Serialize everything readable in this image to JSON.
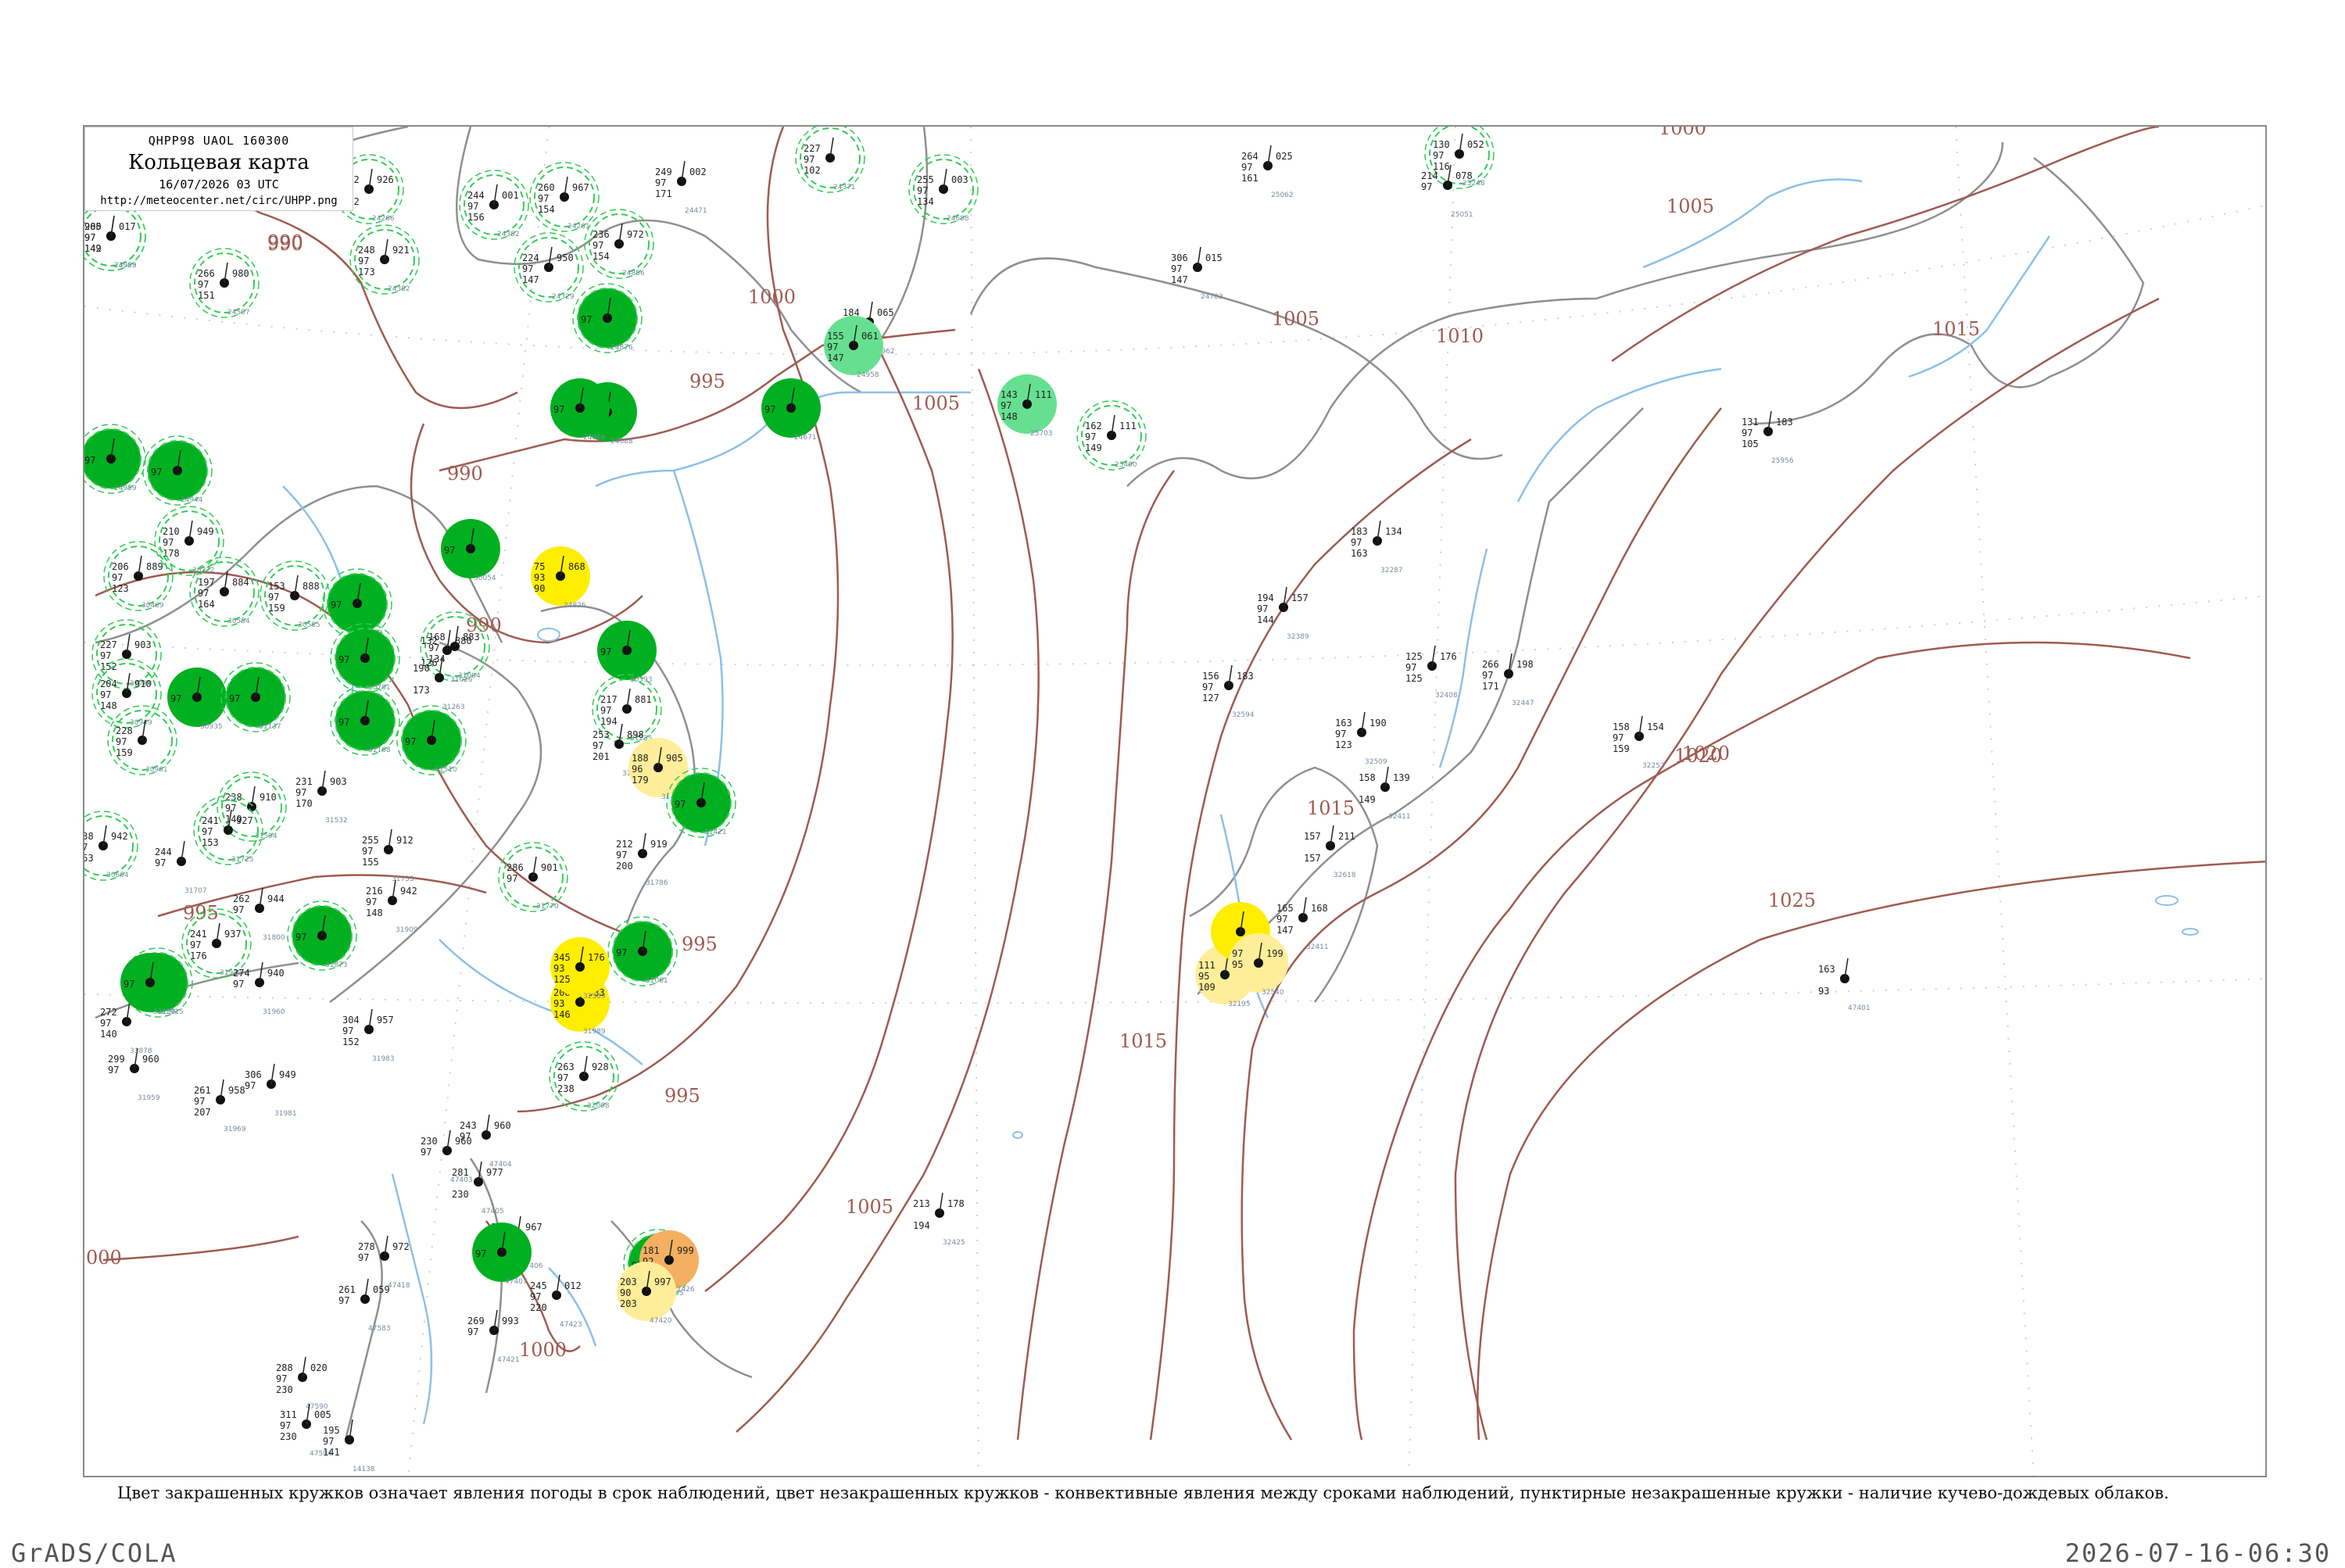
{
  "header": {
    "code": "QHPP98  UAOL  160300",
    "title": "Кольцевая карта",
    "date": "16/07/2026 03 UTC",
    "url": "http://meteocenter.net/circ/UHPP.png"
  },
  "caption": "Цвет закрашенных кружков означает явления погоды в срок наблюдений, цвет незакрашенных кружков - конвективные явления между сроками наблюдений, пунктирные незакрашенные кружки - наличие кучево-дождевых облаков.",
  "footer": {
    "left": "GrADS/COLA",
    "right": "2026-07-16-06:30"
  },
  "colors": {
    "isobar": "#a05a50",
    "coast": "#9a9a9a",
    "river": "#7fb2e0",
    "rain": "#00b020",
    "light_rain": "#66e090",
    "drizzle": "#ffee00",
    "fog": "#ffee99",
    "thunder_dash": "#33cc55",
    "orange": "#f4b060"
  },
  "isobars": [
    {
      "label": "1000",
      "color": "isobar"
    },
    {
      "label": "995",
      "color": "isobar"
    },
    {
      "label": "990",
      "color": "isobar"
    },
    {
      "label": "1005",
      "color": "isobar"
    },
    {
      "label": "1010",
      "color": "isobar"
    },
    {
      "label": "1015",
      "color": "isobar"
    },
    {
      "label": "1020",
      "color": "isobar"
    },
    {
      "label": "1025",
      "color": "isobar"
    },
    {
      "label": "1000",
      "color": "isobar"
    },
    {
      "label": "990",
      "color": "isobar"
    },
    {
      "label": "995",
      "color": "isobar"
    },
    {
      "label": "1005",
      "color": "isobar"
    },
    {
      "label": "1015",
      "color": "isobar"
    },
    {
      "label": "1005",
      "color": "isobar"
    },
    {
      "label": "1015",
      "color": "isobar"
    },
    {
      "label": "990",
      "color": "isobar"
    },
    {
      "label": "995",
      "color": "isobar"
    },
    {
      "label": "1000",
      "color": "isobar"
    },
    {
      "label": "000",
      "color": "isobar"
    },
    {
      "label": "995",
      "color": "isobar"
    },
    {
      "label": "1005",
      "color": "isobar"
    },
    {
      "label": "990",
      "color": "isobar"
    },
    {
      "label": "1020",
      "color": "isobar"
    }
  ],
  "stations": [
    {
      "id": "24959",
      "t": "205",
      "p": "97",
      "d": "149",
      "v": "017",
      "fill": "none",
      "dash": true
    },
    {
      "id": "24266",
      "t": "242",
      "p": "97",
      "d": "252",
      "v": "926",
      "fill": "none",
      "dash": true
    },
    {
      "id": "24382",
      "t": "244",
      "p": "97",
      "d": "156",
      "v": "001",
      "fill": "none",
      "dash": true
    },
    {
      "id": "24261",
      "t": "260",
      "p": "97",
      "d": "154",
      "v": "967",
      "fill": "none",
      "dash": true
    },
    {
      "id": "24471",
      "t": "249",
      "p": "97",
      "d": "171",
      "v": "002",
      "fill": "none",
      "dash": false
    },
    {
      "id": "24371",
      "t": "227",
      "p": "97",
      "d": "102",
      "v": "",
      "fill": "none",
      "dash": true
    },
    {
      "id": "24688",
      "t": "255",
      "p": "97",
      "d": "134",
      "v": "003",
      "fill": "none",
      "dash": true
    },
    {
      "id": "25062",
      "t": "264",
      "p": "97",
      "d": "161",
      "v": "025",
      "fill": "none",
      "dash": false
    },
    {
      "id": "25248",
      "t": "130",
      "p": "97",
      "d": "116",
      "v": "052",
      "fill": "none",
      "dash": true
    },
    {
      "id": "25051",
      "t": "214",
      "p": "97",
      "d": "",
      "v": "078",
      "fill": "none",
      "dash": false
    },
    {
      "id": "24382b",
      "t": "248",
      "p": "97",
      "d": "173",
      "v": "921",
      "fill": "none",
      "dash": true
    },
    {
      "id": "23955",
      "t": "980",
      "p": "97",
      "d": "142",
      "v": "",
      "fill": "none",
      "dash": true
    },
    {
      "id": "24507",
      "t": "266",
      "p": "97",
      "d": "151",
      "v": "980",
      "fill": "none",
      "dash": true
    },
    {
      "id": "24329",
      "t": "224",
      "p": "97",
      "d": "147",
      "v": "950",
      "fill": "none",
      "dash": true
    },
    {
      "id": "24856",
      "t": "236",
      "p": "97",
      "d": "154",
      "v": "972",
      "fill": "none",
      "dash": true
    },
    {
      "id": "24703",
      "t": "306",
      "p": "97",
      "d": "147",
      "v": "015",
      "fill": "none",
      "dash": false
    },
    {
      "id": "24962",
      "t": "184",
      "p": "97",
      "d": "",
      "v": "065",
      "fill": "none",
      "dash": false
    },
    {
      "id": "24958",
      "t": "155",
      "p": "97",
      "d": "147",
      "v": "061",
      "fill": "light_rain",
      "dash": false
    },
    {
      "id": "24876",
      "t": "",
      "p": "97",
      "d": "",
      "v": "",
      "fill": "rain",
      "dash": true
    },
    {
      "id": "24671",
      "t": "",
      "p": "97",
      "d": "",
      "v": "",
      "fill": "rain",
      "dash": false
    },
    {
      "id": "24688b",
      "t": "",
      "p": "97",
      "d": "",
      "v": "",
      "fill": "rain",
      "dash": false
    },
    {
      "id": "24966",
      "t": "",
      "p": "97",
      "d": "",
      "v": "",
      "fill": "rain",
      "dash": false
    },
    {
      "id": "25703",
      "t": "143",
      "p": "97",
      "d": "148",
      "v": "111",
      "fill": "light_rain",
      "dash": false
    },
    {
      "id": "25400",
      "t": "162",
      "p": "97",
      "d": "149",
      "v": "111",
      "fill": "none",
      "dash": true
    },
    {
      "id": "25956",
      "t": "131",
      "p": "97",
      "d": "105",
      "v": "183",
      "fill": "none",
      "dash": false
    },
    {
      "id": "24959b",
      "t": "",
      "p": "97",
      "d": "",
      "v": "",
      "fill": "rain",
      "dash": true
    },
    {
      "id": "24944",
      "t": "",
      "p": "97",
      "d": "",
      "v": "",
      "fill": "rain",
      "dash": true
    },
    {
      "id": "30054",
      "t": "",
      "p": "97",
      "d": "",
      "v": "",
      "fill": "rain",
      "dash": false
    },
    {
      "id": "24826",
      "t": "75",
      "p": "93",
      "d": "90",
      "v": "868",
      "fill": "drizzle",
      "dash": false
    },
    {
      "id": "30372",
      "t": "210",
      "p": "97",
      "d": "178",
      "v": "949",
      "fill": "none",
      "dash": true
    },
    {
      "id": "30469",
      "t": "206",
      "p": "97",
      "d": "123",
      "v": "889",
      "fill": "none",
      "dash": true
    },
    {
      "id": "30554",
      "t": "197",
      "p": "97",
      "d": "164",
      "v": "884",
      "fill": "none",
      "dash": true
    },
    {
      "id": "30565",
      "t": "153",
      "p": "97",
      "d": "159",
      "v": "888",
      "fill": "none",
      "dash": true
    },
    {
      "id": "30673",
      "t": "",
      "p": "97",
      "d": "",
      "v": "",
      "fill": "rain",
      "dash": true
    },
    {
      "id": "30758",
      "t": "227",
      "p": "97",
      "d": "152",
      "v": "903",
      "fill": "none",
      "dash": true
    },
    {
      "id": "31004",
      "t": "168",
      "p": "97",
      "d": "134",
      "v": "883",
      "fill": "none",
      "dash": true
    },
    {
      "id": "31026",
      "t": "132",
      "p": "",
      "d": "126",
      "v": "880",
      "fill": "none",
      "dash": false
    },
    {
      "id": "30781",
      "t": "",
      "p": "97",
      "d": "",
      "v": "",
      "fill": "rain",
      "dash": true
    },
    {
      "id": "30393",
      "t": "",
      "p": "97",
      "d": "",
      "v": "",
      "fill": "rain",
      "dash": false
    },
    {
      "id": "30949",
      "t": "204",
      "p": "97",
      "d": "148",
      "v": "910",
      "fill": "none",
      "dash": true
    },
    {
      "id": "30935",
      "t": "",
      "p": "97",
      "d": "",
      "v": "",
      "fill": "rain",
      "dash": false
    },
    {
      "id": "31137",
      "t": "",
      "p": "97",
      "d": "",
      "v": "",
      "fill": "rain",
      "dash": true
    },
    {
      "id": "31168",
      "t": "",
      "p": "97",
      "d": "",
      "v": "",
      "fill": "rain",
      "dash": true
    },
    {
      "id": "31235",
      "t": "217",
      "p": "97",
      "d": "194",
      "v": "881",
      "fill": "none",
      "dash": true
    },
    {
      "id": "31263",
      "t": "190",
      "p": "",
      "d": "173",
      "v": "",
      "fill": "none",
      "dash": false
    },
    {
      "id": "31369",
      "t": "253",
      "p": "97",
      "d": "201",
      "v": "898",
      "fill": "none",
      "dash": false
    },
    {
      "id": "31418",
      "t": "188",
      "p": "96",
      "d": "179",
      "v": "905",
      "fill": "fog",
      "dash": false
    },
    {
      "id": "31421",
      "t": "",
      "p": "97",
      "d": "",
      "v": "",
      "fill": "rain",
      "dash": true
    },
    {
      "id": "31510",
      "t": "",
      "p": "97",
      "d": "",
      "v": "",
      "fill": "rain",
      "dash": true
    },
    {
      "id": "30961",
      "t": "228",
      "p": "97",
      "d": "159",
      "v": "",
      "fill": "none",
      "dash": true
    },
    {
      "id": "31532",
      "t": "231",
      "p": "97",
      "d": "170",
      "v": "903",
      "fill": "none",
      "dash": false
    },
    {
      "id": "31594",
      "t": "238",
      "p": "97",
      "d": "149",
      "v": "910",
      "fill": "none",
      "dash": true
    },
    {
      "id": "30664",
      "t": "238",
      "p": "97",
      "d": "153",
      "v": "942",
      "fill": "none",
      "dash": true
    },
    {
      "id": "31725",
      "t": "241",
      "p": "97",
      "d": "153",
      "v": "927",
      "fill": "none",
      "dash": true
    },
    {
      "id": "31707",
      "t": "244",
      "p": "97",
      "d": "",
      "v": "",
      "fill": "none",
      "dash": false
    },
    {
      "id": "31733",
      "t": "255",
      "p": "97",
      "d": "155",
      "v": "912",
      "fill": "none",
      "dash": false
    },
    {
      "id": "31786",
      "t": "212",
      "p": "97",
      "d": "200",
      "v": "919",
      "fill": "none",
      "dash": false
    },
    {
      "id": "31770",
      "t": "286",
      "p": "97",
      "d": "",
      "v": "901",
      "fill": "none",
      "dash": true
    },
    {
      "id": "31800",
      "t": "262",
      "p": "97",
      "d": "",
      "v": "944",
      "fill": "none",
      "dash": false
    },
    {
      "id": "31909",
      "t": "216",
      "p": "97",
      "d": "148",
      "v": "942",
      "fill": "none",
      "dash": false
    },
    {
      "id": "31873",
      "t": "",
      "p": "97",
      "d": "",
      "v": "",
      "fill": "rain",
      "dash": true
    },
    {
      "id": "31939",
      "t": "241",
      "p": "97",
      "d": "176",
      "v": "937",
      "fill": "none",
      "dash": true
    },
    {
      "id": "31960",
      "t": "274",
      "p": "97",
      "d": "",
      "v": "940",
      "fill": "none",
      "dash": false
    },
    {
      "id": "31915",
      "t": "",
      "p": "97",
      "d": "",
      "v": "",
      "fill": "rain",
      "dash": true
    },
    {
      "id": "32061",
      "t": "",
      "p": "97",
      "d": "",
      "v": "",
      "fill": "rain",
      "dash": true
    },
    {
      "id": "31989",
      "t": "208",
      "p": "93",
      "d": "146",
      "v": "933",
      "fill": "drizzle",
      "dash": false
    },
    {
      "id": "32098",
      "t": "263",
      "p": "97",
      "d": "238",
      "v": "928",
      "fill": "none",
      "dash": true
    },
    {
      "id": "31983",
      "t": "304",
      "p": "97",
      "d": "152",
      "v": "957",
      "fill": "none",
      "dash": false
    },
    {
      "id": "31969",
      "t": "261",
      "p": "97",
      "d": "207",
      "v": "958",
      "fill": "none",
      "dash": false
    },
    {
      "id": "31981",
      "t": "306",
      "p": "97",
      "d": "",
      "v": "949",
      "fill": "none",
      "dash": false
    },
    {
      "id": "31959",
      "t": "299",
      "p": "97",
      "d": "",
      "v": "960",
      "fill": "none",
      "dash": false
    },
    {
      "id": "31878",
      "t": "272",
      "p": "97",
      "d": "140",
      "v": "",
      "fill": "none",
      "dash": false
    },
    {
      "id": "32150",
      "t": "",
      "p": "97",
      "d": "",
      "v": "",
      "fill": "rain",
      "dash": false
    },
    {
      "id": "32165",
      "t": "",
      "p": "97",
      "d": "",
      "v": "",
      "fill": "rain",
      "dash": true
    },
    {
      "id": "32389",
      "t": "345",
      "p": "93",
      "d": "125",
      "v": "176",
      "fill": "drizzle",
      "dash": false
    },
    {
      "id": "32195",
      "t": "111",
      "p": "95",
      "d": "109",
      "v": "196",
      "fill": "fog",
      "dash": false
    },
    {
      "id": "32411",
      "t": "165",
      "p": "97",
      "d": "147",
      "v": "168",
      "fill": "none",
      "dash": false
    },
    {
      "id": "32389b",
      "t": "",
      "p": "",
      "d": "",
      "v": "",
      "fill": "drizzle",
      "dash": false
    },
    {
      "id": "32540",
      "t": "97",
      "p": "95",
      "d": "",
      "v": "199",
      "fill": "fog",
      "dash": false
    },
    {
      "id": "32252",
      "t": "158",
      "p": "97",
      "d": "159",
      "v": "154",
      "fill": "none",
      "dash": false
    },
    {
      "id": "32287",
      "t": "183",
      "p": "97",
      "d": "163",
      "v": "134",
      "fill": "none",
      "dash": false
    },
    {
      "id": "32389c",
      "t": "194",
      "p": "97",
      "d": "144",
      "v": "157",
      "fill": "none",
      "dash": false
    },
    {
      "id": "32408",
      "t": "125",
      "p": "97",
      "d": "125",
      "v": "176",
      "fill": "none",
      "dash": false
    },
    {
      "id": "32447",
      "t": "266",
      "p": "97",
      "d": "171",
      "v": "198",
      "fill": "none",
      "dash": false
    },
    {
      "id": "32509",
      "t": "163",
      "p": "97",
      "d": "123",
      "v": "190",
      "fill": "none",
      "dash": false
    },
    {
      "id": "32411b",
      "t": "158",
      "p": "",
      "d": "149",
      "v": "139",
      "fill": "none",
      "dash": false
    },
    {
      "id": "32594",
      "t": "156",
      "p": "97",
      "d": "127",
      "v": "183",
      "fill": "none",
      "dash": false
    },
    {
      "id": "32618",
      "t": "157",
      "p": "",
      "d": "157",
      "v": "211",
      "fill": "none",
      "dash": false
    },
    {
      "id": "47401",
      "t": "163",
      "p": "",
      "d": "93",
      "v": "",
      "fill": "none",
      "dash": false
    },
    {
      "id": "47403",
      "t": "230",
      "p": "97",
      "d": "",
      "v": "960",
      "fill": "none",
      "dash": false
    },
    {
      "id": "47404",
      "t": "243",
      "p": "97",
      "d": "",
      "v": "960",
      "fill": "none",
      "dash": false
    },
    {
      "id": "47405",
      "t": "281",
      "p": "",
      "d": "230",
      "v": "977",
      "fill": "none",
      "dash": false
    },
    {
      "id": "47406",
      "t": "255",
      "p": "97",
      "d": "207",
      "v": "967",
      "fill": "none",
      "dash": false
    },
    {
      "id": "47407",
      "t": "",
      "p": "97",
      "d": "",
      "v": "",
      "fill": "rain",
      "dash": false
    },
    {
      "id": "47426",
      "t": "181",
      "p": "92",
      "d": "181",
      "v": "999",
      "fill": "orange",
      "dash": false
    },
    {
      "id": "47420",
      "t": "203",
      "p": "90",
      "d": "203",
      "v": "997",
      "fill": "fog",
      "dash": false
    },
    {
      "id": "47421",
      "t": "269",
      "p": "97",
      "d": "",
      "v": "993",
      "fill": "none",
      "dash": false
    },
    {
      "id": "47418",
      "t": "278",
      "p": "97",
      "d": "",
      "v": "972",
      "fill": "none",
      "dash": false
    },
    {
      "id": "47423",
      "t": "245",
      "p": "97",
      "d": "220",
      "v": "012",
      "fill": "none",
      "dash": false
    },
    {
      "id": "47583",
      "t": "261",
      "p": "97",
      "d": "",
      "v": "059",
      "fill": "none",
      "dash": false
    },
    {
      "id": "47590",
      "t": "288",
      "p": "97",
      "d": "230",
      "v": "020",
      "fill": "none",
      "dash": false
    },
    {
      "id": "47594",
      "t": "311",
      "p": "97",
      "d": "230",
      "v": "005",
      "fill": "none",
      "dash": false
    },
    {
      "id": "14138",
      "t": "195",
      "p": "97",
      "d": "141",
      "v": "",
      "fill": "none",
      "dash": false
    },
    {
      "id": "32425",
      "t": "213",
      "p": "",
      "d": "194",
      "v": "178",
      "fill": "none",
      "dash": false
    }
  ]
}
